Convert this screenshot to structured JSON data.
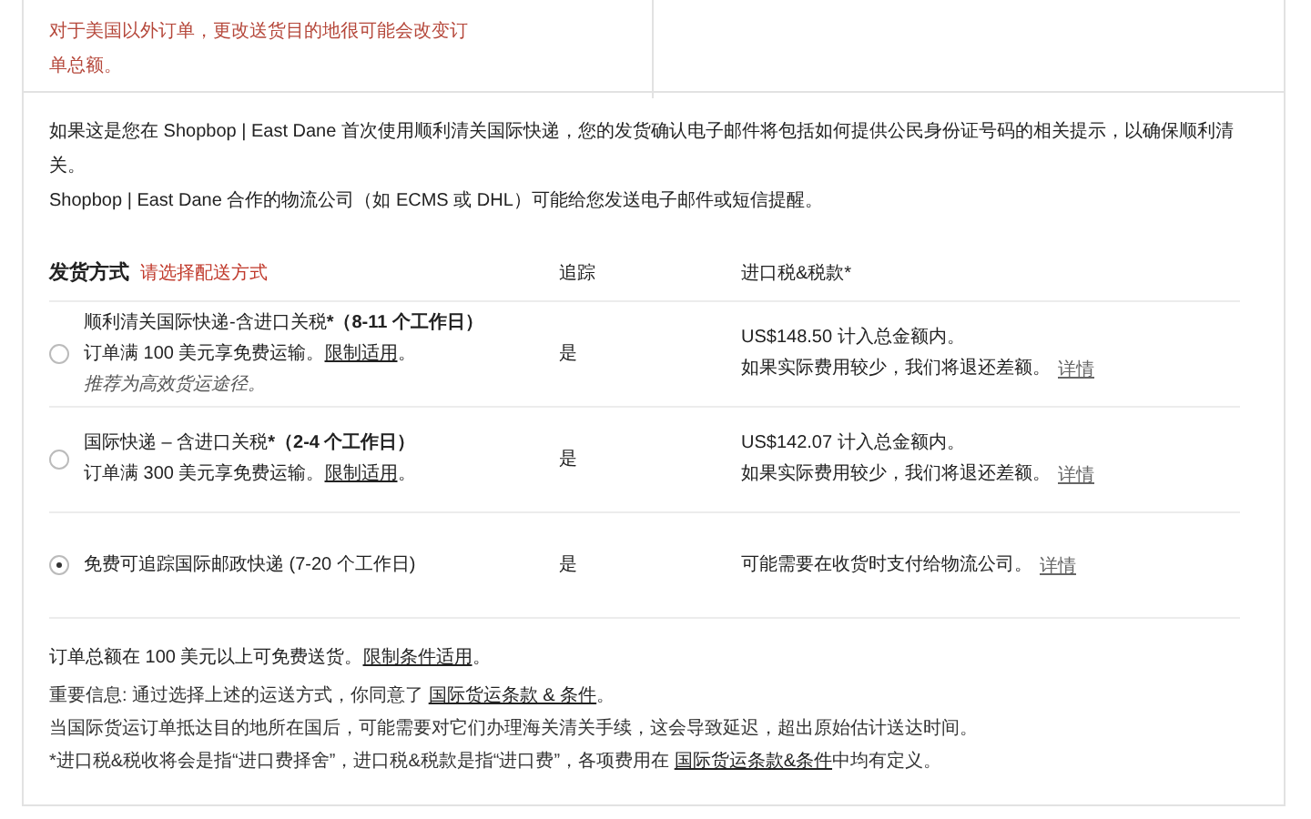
{
  "top_notice": {
    "text": "对于美国以外订单，更改送货目的地很可能会改变订单总额。"
  },
  "intro": {
    "lines": [
      "如果这是您在 Shopbop | East Dane 首次使用顺利清关国际快递，您的发货确认电子邮件将包括如何提供公民身份证号码的相关提示，以确保顺利清关。",
      "Shopbop | East Dane 合作的物流公司（如 ECMS 或 DHL）可能给您发送电子邮件或短信提醒。"
    ]
  },
  "table": {
    "columns": [
      "发货方式",
      "追踪",
      "进口税&税款*"
    ],
    "prompt": "请选择配送方式",
    "rows": [
      {
        "selected": false,
        "title": "顺利清关国际快递-含进口关税***（8-11 个工作日）**",
        "note": {
          "before": "订单满 100 美元享免费运输。",
          "link": "限制适用",
          "after": "。"
        },
        "recommendation": "推荐为高效货运途径。",
        "tracking": "是",
        "duties": [
          "US$148.50 计入总金额内。",
          "如果实际费用较少，我们将退还差额。"
        ],
        "details_link": "详情"
      },
      {
        "selected": false,
        "title": "国际快递 – 含进口关税***（2-4 个工作日）**",
        "note": {
          "before": "订单满 300 美元享免费运输。",
          "link": "限制适用",
          "after": "。"
        },
        "tracking": "是",
        "duties": [
          "US$142.07 计入总金额内。",
          "如果实际费用较少，我们将退还差额。"
        ],
        "details_link": "详情"
      },
      {
        "selected": true,
        "title": "免费可追踪国际邮政快递 (7-20 个工作日)",
        "tracking": "是",
        "duties": [
          "可能需要在收货时支付给物流公司。"
        ],
        "details_link": "详情"
      }
    ]
  },
  "footer": {
    "free_shipping": {
      "before": "订单总额在 100 美元以上可免费送货。",
      "link": "限制条件适用",
      "after": "。"
    },
    "fine_print": [
      {
        "before": "重要信息: 通过选择上述的运送方式，你同意了 ",
        "link": "国际货运条款 & 条件",
        "after": "。"
      },
      {
        "before": "当国际货运订单抵达目的地所在国后，可能需要对它们办理海关清关手续，这会导致延迟，超出原始估计送达时间。"
      },
      {
        "before": "*进口税&税收将会是指“进口费择舍”，进口税&税款是指“进口费”，各项费用在 ",
        "link": "国际货运条款&条件",
        "after": "中均有定义。"
      }
    ]
  }
}
